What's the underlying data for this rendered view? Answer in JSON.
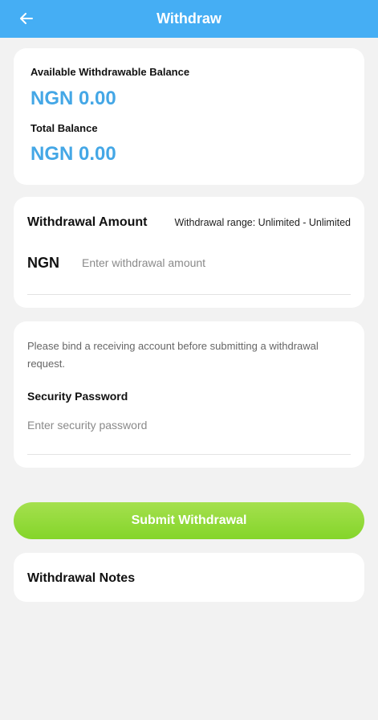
{
  "header": {
    "title": "Withdraw",
    "back_icon": "arrow-left-icon",
    "color": "#45aef4"
  },
  "balance": {
    "available_label": "Available Withdrawable Balance",
    "available_value": "NGN 0.00",
    "total_label": "Total Balance",
    "total_value": "NGN 0.00",
    "accent": "#44a7e6"
  },
  "withdrawal": {
    "amount_label": "Withdrawal Amount",
    "range_text": "Withdrawal range: Unlimited - Unlimited",
    "currency": "NGN",
    "amount_value": "",
    "amount_placeholder": "Enter withdrawal amount"
  },
  "account": {
    "notice": "Please bind a receiving account before submitting a withdrawal request.",
    "password_label": "Security Password",
    "password_value": "",
    "password_placeholder": "Enter security password"
  },
  "actions": {
    "submit_label": "Submit Withdrawal",
    "submit_color": "#8fd83a"
  },
  "notes": {
    "title": "Withdrawal Notes"
  }
}
